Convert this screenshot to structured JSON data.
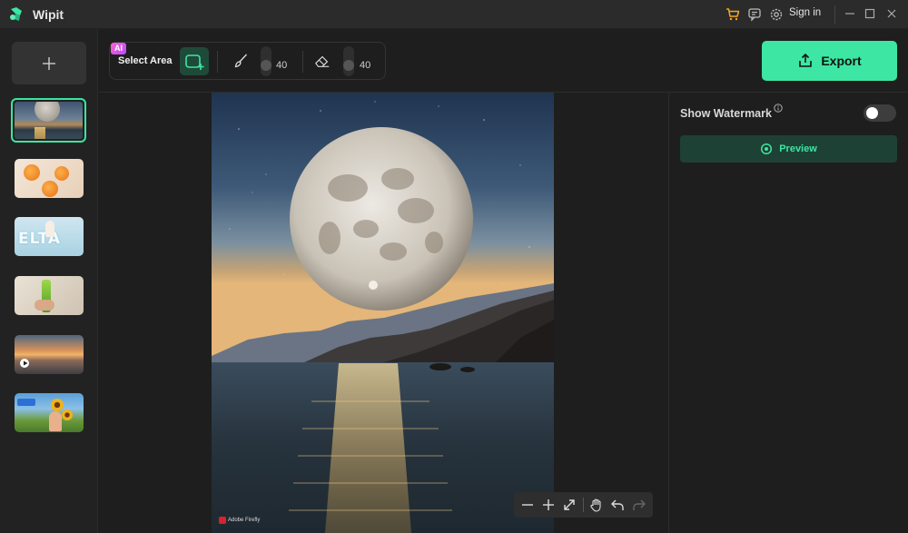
{
  "app": {
    "title": "Wipit",
    "sign_in": "Sign in"
  },
  "toolbar": {
    "ai_badge": "AI",
    "select_area_label": "Select Area",
    "brush_size": "40",
    "eraser_size": "40"
  },
  "export": {
    "label": "Export"
  },
  "right_panel": {
    "watermark_label": "Show Watermark",
    "watermark_enabled": false,
    "preview_label": "Preview"
  },
  "canvas": {
    "credit": "Adobe Firefly"
  },
  "sidebar": {
    "thumbnails": [
      {
        "name": "moon-seascape",
        "active": true
      },
      {
        "name": "oranges"
      },
      {
        "name": "ice-cream-text"
      },
      {
        "name": "green-bottle"
      },
      {
        "name": "sunset-beach-video"
      },
      {
        "name": "sunflowers-woman"
      }
    ]
  },
  "colors": {
    "accent": "#3de6a2",
    "cart": "#f5a623"
  }
}
